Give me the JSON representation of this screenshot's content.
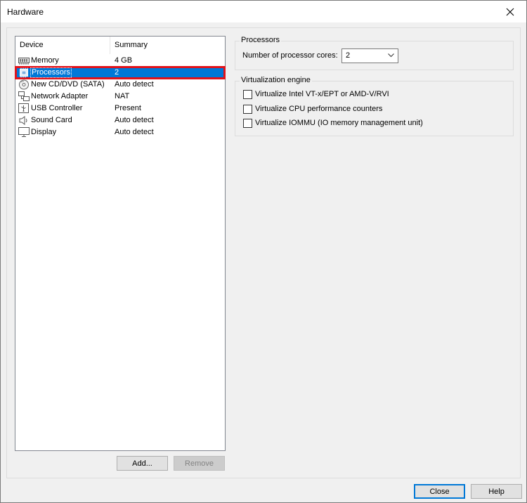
{
  "window": {
    "title": "Hardware"
  },
  "device_list": {
    "columns": {
      "device": "Device",
      "summary": "Summary"
    },
    "rows": [
      {
        "device": "Memory",
        "summary": "4 GB",
        "icon": "memory-icon"
      },
      {
        "device": "Processors",
        "summary": "2",
        "icon": "processor-icon",
        "selected": true
      },
      {
        "device": "New CD/DVD (SATA)",
        "summary": "Auto detect",
        "icon": "cd-dvd-icon"
      },
      {
        "device": "Network Adapter",
        "summary": "NAT",
        "icon": "network-adapter-icon"
      },
      {
        "device": "USB Controller",
        "summary": "Present",
        "icon": "usb-controller-icon"
      },
      {
        "device": "Sound Card",
        "summary": "Auto detect",
        "icon": "sound-card-icon"
      },
      {
        "device": "Display",
        "summary": "Auto detect",
        "icon": "display-icon"
      }
    ]
  },
  "buttons": {
    "add": "Add...",
    "remove": "Remove",
    "close": "Close",
    "help": "Help"
  },
  "processors": {
    "group_title": "Processors",
    "cores_label": "Number of processor cores:",
    "cores_value": "2"
  },
  "virtualization": {
    "group_title": "Virtualization engine",
    "options": [
      {
        "label": "Virtualize Intel VT-x/EPT or AMD-V/RVI",
        "checked": false
      },
      {
        "label": "Virtualize CPU performance counters",
        "checked": false
      },
      {
        "label": "Virtualize IOMMU (IO memory management unit)",
        "checked": false
      }
    ]
  },
  "colors": {
    "selection": "#0078d7",
    "highlight_border": "#e0131b",
    "default_button_border": "#0078d7"
  }
}
